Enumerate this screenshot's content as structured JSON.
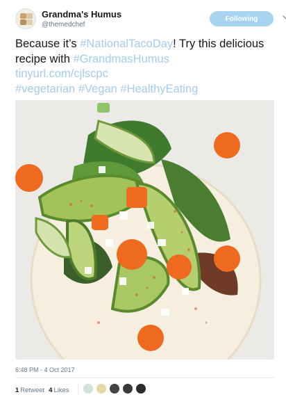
{
  "account": {
    "display_name": "Grandma's Humus",
    "handle": "@themedchef",
    "follow_label": "Following"
  },
  "tweet": {
    "text_1": "Because it’s ",
    "hashtag_1": "#NationalTacoDay",
    "text_2": "! Try this delicious recipe with ",
    "hashtag_2": "#GrandmasHumus",
    "link": "tinyurl.com/cjlscpc",
    "hashtag_3": "#vegetarian",
    "hashtag_4": "#Vegan",
    "hashtag_5": "#HealthyEating"
  },
  "meta": {
    "timestamp": "6:48 PM - 4 Oct 2017",
    "retweet_count": "1",
    "retweet_label": "Retweet",
    "like_count": "4",
    "like_label": "Likes"
  },
  "colors": {
    "link": "#a3cdee",
    "follow_button": "#a8d4f2",
    "secondary_text": "#657786"
  },
  "icons": {
    "chevron": "chevron-down-icon"
  }
}
